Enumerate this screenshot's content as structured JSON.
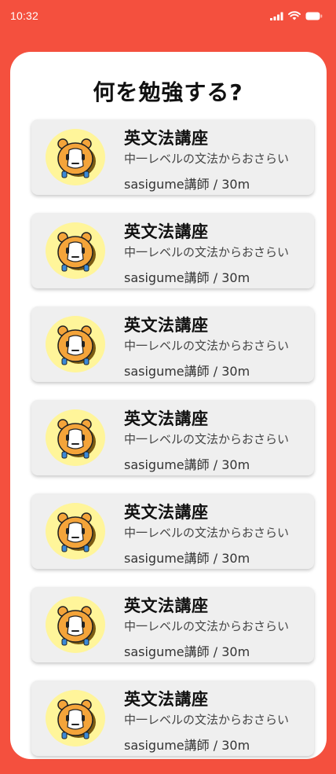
{
  "status_bar": {
    "time": "10:32",
    "icons": [
      "cellular-signal-icon",
      "wifi-icon",
      "battery-icon"
    ]
  },
  "page": {
    "title": "何を勉強する?"
  },
  "courses": [
    {
      "title": "英文法講座",
      "subtitle": "中一レベルの文法からおさらい",
      "meta": "sasigume講師 / 30m",
      "thumbnail": "hamster-mascot-icon"
    },
    {
      "title": "英文法講座",
      "subtitle": "中一レベルの文法からおさらい",
      "meta": "sasigume講師 / 30m",
      "thumbnail": "hamster-mascot-icon"
    },
    {
      "title": "英文法講座",
      "subtitle": "中一レベルの文法からおさらい",
      "meta": "sasigume講師 / 30m",
      "thumbnail": "hamster-mascot-icon"
    },
    {
      "title": "英文法講座",
      "subtitle": "中一レベルの文法からおさらい",
      "meta": "sasigume講師 / 30m",
      "thumbnail": "hamster-mascot-icon"
    },
    {
      "title": "英文法講座",
      "subtitle": "中一レベルの文法からおさらい",
      "meta": "sasigume講師 / 30m",
      "thumbnail": "hamster-mascot-icon"
    },
    {
      "title": "英文法講座",
      "subtitle": "中一レベルの文法からおさらい",
      "meta": "sasigume講師 / 30m",
      "thumbnail": "hamster-mascot-icon"
    },
    {
      "title": "英文法講座",
      "subtitle": "中一レベルの文法からおさらい",
      "meta": "sasigume講師 / 30m",
      "thumbnail": "hamster-mascot-icon"
    }
  ],
  "colors": {
    "background": "#f4503e",
    "panel": "#ffffff",
    "card": "#efefef",
    "mascot_circle": "#fff59a",
    "mascot_body": "#f4a43a"
  }
}
